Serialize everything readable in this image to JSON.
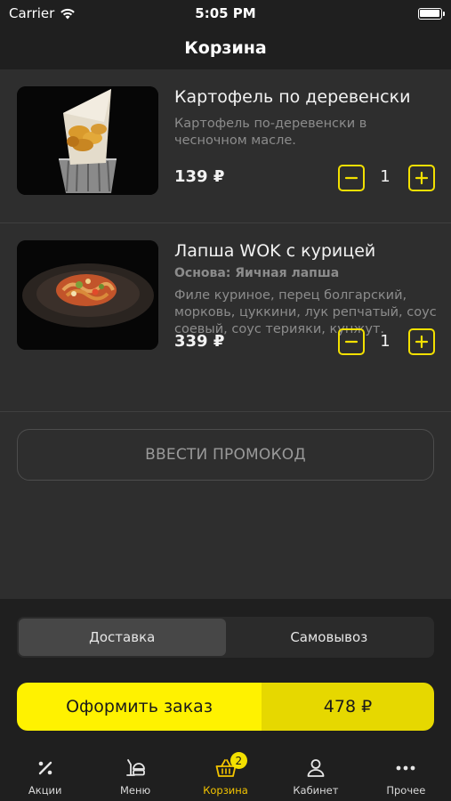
{
  "status_bar": {
    "carrier": "Carrier",
    "time": "5:05 PM"
  },
  "header": {
    "title": "Корзина"
  },
  "cart": {
    "items": [
      {
        "name": "Картофель по деревенски",
        "description": "Картофель по-деревенски в чесночном масле.",
        "price": "139 ₽",
        "quantity": "1"
      },
      {
        "name": "Лапша WOK с курицей",
        "base": "Основа: Яичная лапша",
        "description": "Филе куриное, перец болгарский, морковь, цуккини, лук репчатый, соус соевый, соус терияки, кунжут.",
        "price": "339 ₽",
        "quantity": "1"
      }
    ],
    "promo_label": "ВВЕСТИ ПРОМОКОД"
  },
  "delivery": {
    "options": [
      "Доставка",
      "Самовывоз"
    ],
    "selected": "Доставка"
  },
  "checkout": {
    "label": "Оформить заказ",
    "total": "478 ₽"
  },
  "tab_bar": {
    "tabs": [
      {
        "label": "Акции",
        "icon": "percent-icon"
      },
      {
        "label": "Меню",
        "icon": "menu-food-icon"
      },
      {
        "label": "Корзина",
        "icon": "basket-icon",
        "badge": "2"
      },
      {
        "label": "Кабинет",
        "icon": "user-icon"
      },
      {
        "label": "Прочее",
        "icon": "more-icon"
      }
    ],
    "active": "Корзина"
  },
  "colors": {
    "accent": "#fff200",
    "accent_dark": "#e6d800",
    "active_tab": "#f3c400",
    "background": "#2e2e2e",
    "panel": "#1f1f1f"
  }
}
